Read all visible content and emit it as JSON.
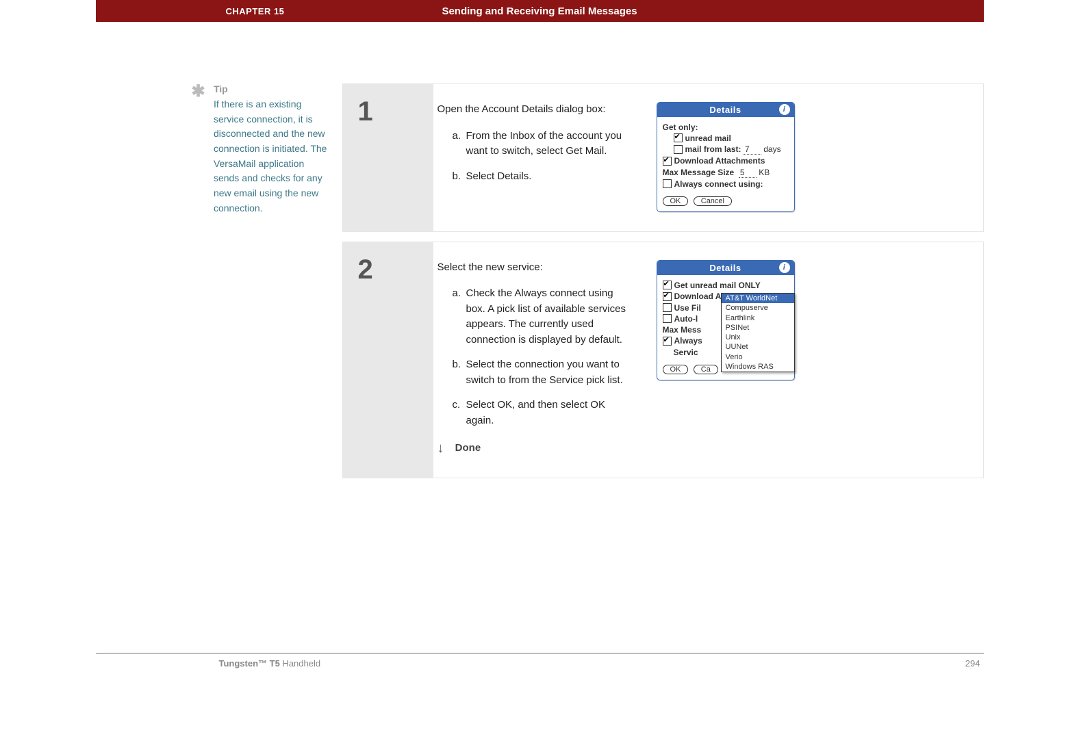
{
  "header": {
    "chapter": "CHAPTER 15",
    "title": "Sending and Receiving Email Messages"
  },
  "tip": {
    "label": "Tip",
    "text": "If there is an existing service connection, it is disconnected and the new connection is initiated. The VersaMail application sends and checks for any new email using the new connection."
  },
  "steps": [
    {
      "num": "1",
      "lead": "Open the Account Details dialog box:",
      "subs": [
        {
          "lab": "a.",
          "txt": "From the Inbox of the account you want to switch, select Get Mail."
        },
        {
          "lab": "b.",
          "txt": "Select Details."
        }
      ]
    },
    {
      "num": "2",
      "lead": "Select the new service:",
      "subs": [
        {
          "lab": "a.",
          "txt": "Check the Always connect using box. A pick list of available services appears. The currently used connection is displayed by default."
        },
        {
          "lab": "b.",
          "txt": "Select the connection you want to switch to from the Service pick list."
        },
        {
          "lab": "c.",
          "txt": "Select OK, and then select OK again."
        }
      ],
      "done": "Done"
    }
  ],
  "palm1": {
    "title": "Details",
    "getonly": "Get only:",
    "unread": "unread mail",
    "mailfrom": "mail from last:",
    "mailfrom_val": "7",
    "mailfrom_unit": "days",
    "download": "Download Attachments",
    "maxmsg": "Max Message Size",
    "maxmsg_val": "5",
    "maxmsg_unit": "KB",
    "always": "Always connect using:",
    "ok": "OK",
    "cancel": "Cancel"
  },
  "palm2": {
    "title": "Details",
    "getunread": "Get unread mail ONLY",
    "download": "Download Attachments",
    "usefil": "Use Fil",
    "autol": "Auto-l",
    "maxmess": "Max Mess",
    "always": "Always",
    "servic": "Servic",
    "ok": "OK",
    "ca": "Ca",
    "picklist": [
      "AT&T WorldNet",
      "Compuserve",
      "Earthlink",
      "PSINet",
      "Unix",
      "UUNet",
      "Verio",
      "Windows RAS"
    ]
  },
  "footer": {
    "product_bold": "Tungsten™ T5",
    "product_rest": " Handheld",
    "page": "294"
  }
}
